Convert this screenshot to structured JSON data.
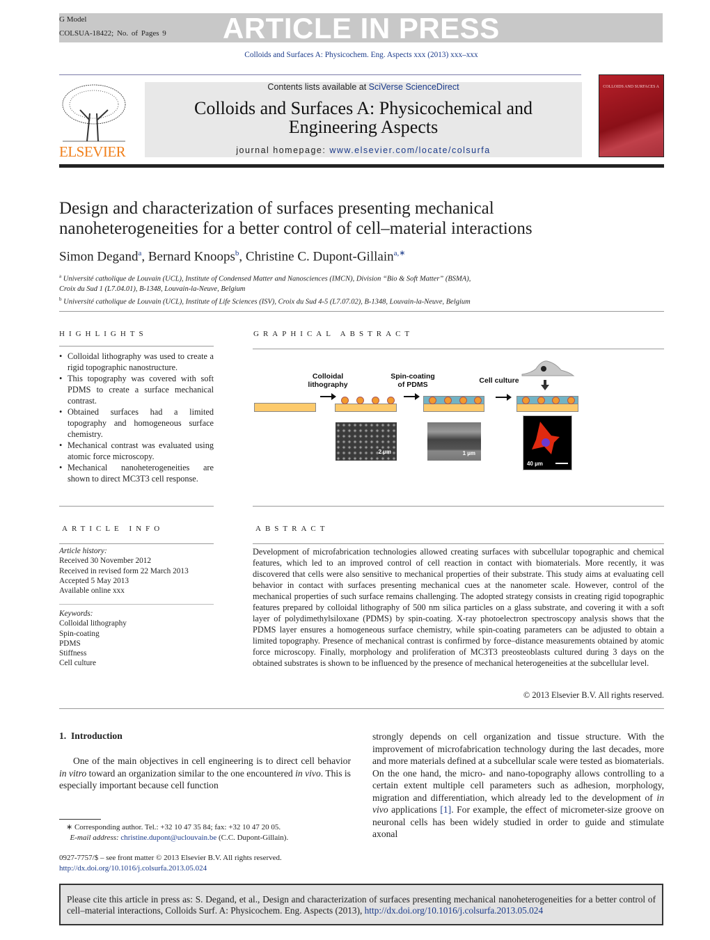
{
  "banner": {
    "g_model": "G Model",
    "article_id": "COLSUA-18422;",
    "pages": "No. of Pages 9",
    "article_in_press": "ARTICLE IN PRESS"
  },
  "citation_line": "Colloids and Surfaces A: Physicochem. Eng. Aspects xxx (2013) xxx–xxx",
  "journal": {
    "contents_prefix": "Contents lists available at ",
    "sciencedirect": "SciVerse ScienceDirect",
    "title_line1": "Colloids and Surfaces A: Physicochemical and",
    "title_line2": "Engineering Aspects",
    "homepage_prefix": "journal homepage: ",
    "homepage_url": "www.elsevier.com/locate/colsurfa",
    "publisher": "ELSEVIER",
    "cover_title": "COLLOIDS AND SURFACES A"
  },
  "article": {
    "title_line1": "Design and characterization of surfaces presenting mechanical",
    "title_line2": "nanoheterogeneities for a better control of cell–material interactions",
    "authors": [
      {
        "name": "Simon Degand",
        "sup": "a"
      },
      {
        "name": "Bernard Knoops",
        "sup": "b"
      },
      {
        "name": "Christine C. Dupont-Gillain",
        "sup": "a,∗"
      }
    ],
    "affiliation_a_line1": "Université catholique de Louvain (UCL), Institute of Condensed Matter and Nanosciences (IMCN), Division “Bio & Soft Matter” (BSMA),",
    "affiliation_a_line2": "Croix du Sud 1 (L7.04.01), B-1348, Louvain-la-Neuve, Belgium",
    "affiliation_b": "Université catholique de Louvain (UCL), Institute of Life Sciences (ISV), Croix du Sud 4-5 (L7.07.02), B-1348, Louvain-la-Neuve, Belgium"
  },
  "highlights": {
    "heading": "HIGHLIGHTS",
    "items": [
      "Colloidal lithography was used to create a rigid topographic nanostructure.",
      "This topography was covered with soft PDMS to create a surface mechanical contrast.",
      "Obtained surfaces had a limited topography and homogeneous surface chemistry.",
      "Mechanical contrast was evaluated using atomic force microscopy.",
      "Mechanical nanoheterogeneities are shown to direct MC3T3 cell response."
    ]
  },
  "graphical_abstract": {
    "heading": "GRAPHICAL ABSTRACT",
    "step1": "Colloidal lithography",
    "step2": "Spin-coating of PDMS",
    "step3": "Cell culture",
    "scale1": "2 µm",
    "scale2": "1 µm",
    "scale3": "40 µm"
  },
  "article_info": {
    "heading": "ARTICLE INFO",
    "history_label": "Article history:",
    "received": "Received 30 November 2012",
    "revised": "Received in revised form 22 March 2013",
    "accepted": "Accepted 5 May 2013",
    "online": "Available online xxx",
    "keywords_label": "Keywords:",
    "keywords": [
      "Colloidal lithography",
      "Spin-coating",
      "PDMS",
      "Stiffness",
      "Cell culture"
    ]
  },
  "abstract": {
    "heading": "ABSTRACT",
    "text": "Development of microfabrication technologies allowed creating surfaces with subcellular topographic and chemical features, which led to an improved control of cell reaction in contact with biomaterials. More recently, it was discovered that cells were also sensitive to mechanical properties of their substrate. This study aims at evaluating cell behavior in contact with surfaces presenting mechanical cues at the nanometer scale. However, control of the mechanical properties of such surface remains challenging. The adopted strategy consists in creating rigid topographic features prepared by colloidal lithography of 500 nm silica particles on a glass substrate, and covering it with a soft layer of polydimethylsiloxane (PDMS) by spin-coating. X-ray photoelectron spectroscopy analysis shows that the PDMS layer ensures a homogeneous surface chemistry, while spin-coating parameters can be adjusted to obtain a limited topography. Presence of mechanical contrast is confirmed by force–distance measurements obtained by atomic force microscopy. Finally, morphology and proliferation of MC3T3 preosteoblasts cultured during 3 days on the obtained substrates is shown to be influenced by the presence of mechanical heterogeneities at the subcellular level.",
    "copyright": "© 2013 Elsevier B.V. All rights reserved."
  },
  "intro": {
    "heading_num": "1.",
    "heading": "Introduction",
    "p1_a": "One of the main objectives in cell engineering is to direct cell behavior ",
    "p1_i1": "in vitro",
    "p1_b": " toward an organization similar to the one encountered ",
    "p1_i2": "in vivo",
    "p1_c": ". This is especially important because cell function",
    "p2_a": "strongly depends on cell organization and tissue structure. With the improvement of microfabrication technology during the last decades, more and more materials defined at a subcellular scale were tested as biomaterials. On the one hand, the micro- and nano-topography allows controlling to a certain extent multiple cell parameters such as adhesion, morphology, migration and differentiation, which already led to the development of ",
    "p2_i": "in vivo",
    "p2_b": " applications ",
    "p2_ref": "[1]",
    "p2_c": ". For example, the effect of micrometer-size groove on neuronal cells has been widely studied in order to guide and stimulate axonal"
  },
  "footnote": {
    "corresponding": "∗ Corresponding author. Tel.: +32 10 47 35 84; fax: +32 10 47 20 05.",
    "email_label": "E-mail address:",
    "email": "christine.dupont@uclouvain.be",
    "email_suffix": " (C.C. Dupont-Gillain).",
    "front_matter": "0927-7757/$ – see front matter © 2013 Elsevier B.V. All rights reserved.",
    "doi": "http://dx.doi.org/10.1016/j.colsurfa.2013.05.024"
  },
  "cite_box": {
    "text": "Please cite this article in press as: S. Degand, et al., Design and characterization of surfaces presenting mechanical nanoheterogeneities for a better control of cell–material interactions, Colloids Surf. A: Physicochem. Eng. Aspects (2013), ",
    "doi": "http://dx.doi.org/10.1016/j.colsurfa.2013.05.024"
  },
  "colors": {
    "link": "#1a3a8a",
    "elsevier_orange": "#f07f1a",
    "banner_grey": "#c8c8c8",
    "substrate": "#fcca6c",
    "pdms": "#72b3c4",
    "particle": "#f29a2e"
  }
}
